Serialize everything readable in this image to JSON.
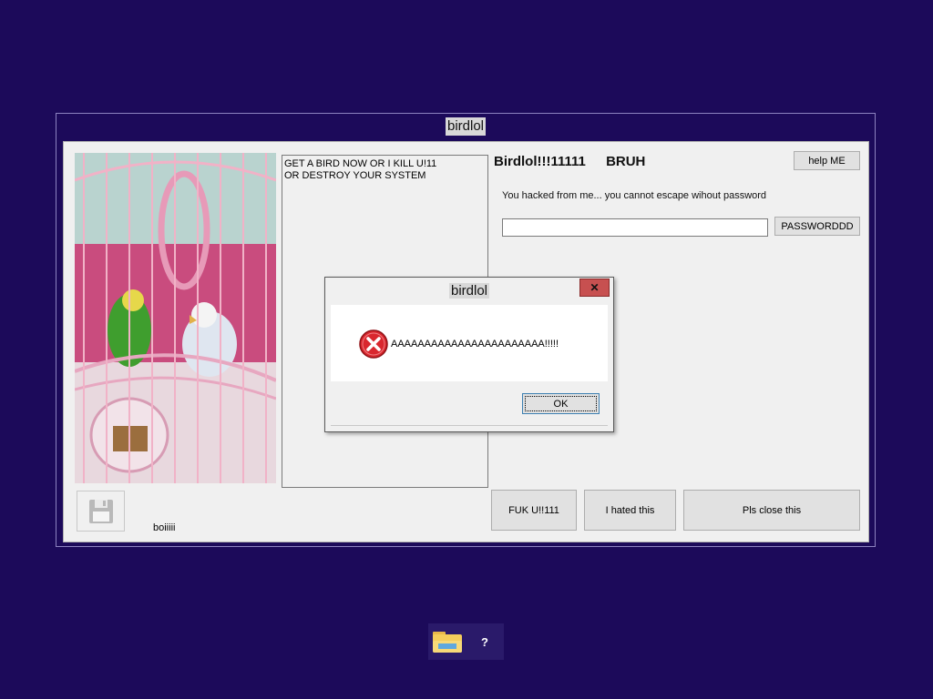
{
  "window": {
    "title": "birdlol"
  },
  "main": {
    "textbox_lines": [
      "GET A BIRD NOW OR I KILL U!11",
      "OR DESTROY YOUR SYSTEM"
    ],
    "heading_left": "Birdlol!!!11111",
    "heading_right": "BRUH",
    "help_button": "help ME",
    "prompt": "You hacked from me... you cannot escape wihout password",
    "password_value": "",
    "password_button": "PASSWORDDD",
    "save_label": "boiiiii",
    "buttons": [
      "FUK U!!111",
      "I hated this",
      "Pls close this"
    ]
  },
  "dialog": {
    "title": "birdlol",
    "close_glyph": "✕",
    "message": "AAAAAAAAAAAAAAAAAAAAAAA!!!!!",
    "ok": "OK",
    "icon": "error-icon"
  },
  "taskbar": {
    "items": [
      {
        "icon": "file-explorer-icon"
      },
      {
        "icon": "unknown-app-icon",
        "glyph": "?"
      }
    ]
  },
  "colors": {
    "desktop": "#1c0a5a",
    "window_border": "#8d83c0",
    "client": "#f0f0f0",
    "close_red": "#c75050",
    "error_red": "#d9272e"
  }
}
